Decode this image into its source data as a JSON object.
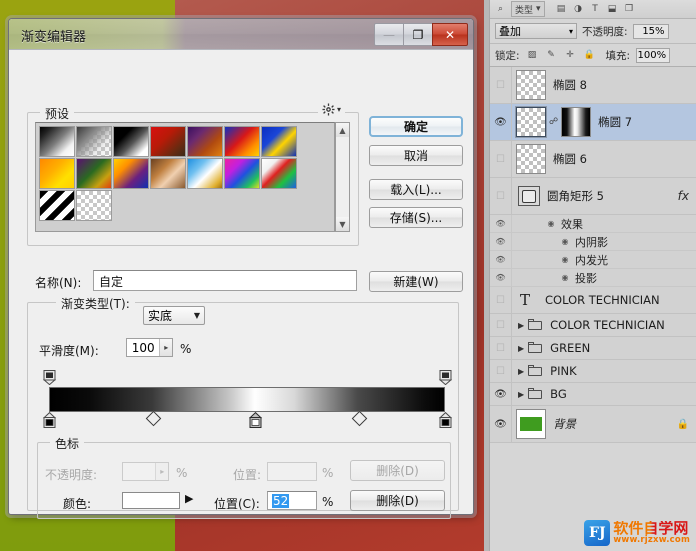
{
  "dialog": {
    "title": "渐变编辑器",
    "window_buttons": [
      {
        "name": "minimize",
        "glyph": "—",
        "state": "disabled"
      },
      {
        "name": "maximize",
        "glyph": "❐",
        "state": "enabled"
      },
      {
        "name": "close",
        "glyph": "✕",
        "state": "enabled"
      }
    ],
    "presets": {
      "label": "预设",
      "gear_icon": "gear-icon",
      "scroll_up": "▲",
      "scroll_down": "▼",
      "swatches": [
        "linear-gradient(135deg,#000 0%,#222 18%,#7d7d7d 50%,#f2f2f2 78%,#fff 100%)",
        "linear-gradient(135deg,#3a3a3a 0%,#8a8a8a 35%,rgba(180,180,180,0.25) 70%,rgba(255,255,255,0) 100%)",
        "linear-gradient(135deg,#000 0%,#000 30%,#555 55%,#fff 85%,#fff 100%)",
        "linear-gradient(135deg,#d81010 0%,#b81a08 40%,#6a2a10 75%,#3c2a18 100%)",
        "linear-gradient(135deg,#3a1060 0%,#6b2a70 30%,#b04a10 65%,#e08010 100%)",
        "linear-gradient(135deg,#1030c0 0%,#d81818 45%,#ff8c00 75%,#ffd000 100%)",
        "linear-gradient(135deg,#0a2ec0 0%,#1a46d8 35%,#ffd400 60%,#1030b8 100%)",
        "linear-gradient(135deg,#ff8800 0%,#ffb000 40%,#ffe000 70%,#ffd000 100%)",
        "linear-gradient(135deg,#5a1070 0%,#2a6a20 45%,#c8a010 75%,#e04010 100%)",
        "linear-gradient(135deg,#ffd000 0%,#ff9000 30%,#6a2080 65%,#1030b0 100%)",
        "linear-gradient(135deg,#6a4020 0%,#c08040 35%,#f0d0b0 60%,#8a5a30 100%)",
        "linear-gradient(135deg,#2090e0 0%,#70c0f0 30%,#ffffff 55%,#e0b030 85%,#a07010 100%)",
        "linear-gradient(135deg,#f020a0 0%,#c020e0 30%,#2050e0 55%,#20c060 80%,#e0e020 100%)",
        "linear-gradient(135deg,#ffffff 0%,#f0f0f0 25%,#e02020 45%,#20c040 70%,#2060e0 100%)",
        "repeating-linear-gradient(135deg,#000 0 6px,#fff 6px 12px)"
      ],
      "transparent_swatch_indexes": [
        1,
        15
      ]
    },
    "buttons": {
      "ok": "确定",
      "cancel": "取消",
      "load": "载入(L)...",
      "save": "存储(S)...",
      "new": "新建(W)"
    },
    "name_row": {
      "label": "名称(N):",
      "value": "自定"
    },
    "gradient_type": {
      "group_label": "渐变类型(T):",
      "value": "实底",
      "caret": "▼"
    },
    "smoothness": {
      "label": "平滑度(M):",
      "value": "100",
      "unit": "%",
      "arrow": "▸"
    },
    "gradient_bar": {
      "css": "linear-gradient(90deg,#000000 0%,#0a0a0a 10%,#3a3a3a 26%,#c9c9c9 46%,#ffffff 52%,#d8d8d8 62%,#4a4a4a 78%,#0c0c0c 95%,#000000 100%)",
      "opacity_stops": [
        {
          "position": 0,
          "opacity": 100
        },
        {
          "position": 100,
          "opacity": 100
        }
      ],
      "color_stops": [
        {
          "position": 0,
          "color": "#000000",
          "selected": false
        },
        {
          "position": 52,
          "color": "#ffffff",
          "selected": true
        },
        {
          "position": 100,
          "color": "#000000",
          "selected": false
        }
      ],
      "midpoints": [
        26,
        78
      ]
    },
    "stops_group": {
      "label": "色标",
      "opacity_label": "不透明度:",
      "opacity_value": "",
      "opacity_unit": "%",
      "opacity_position_label": "位置:",
      "opacity_position_value": "",
      "opacity_position_unit": "%",
      "delete_opacity": "删除(D)",
      "color_label": "颜色:",
      "color_value": "#ffffff",
      "color_caret": "▶",
      "color_position_label": "位置(C):",
      "color_position_value": "52",
      "color_position_unit": "%",
      "delete_color": "删除(D)"
    }
  },
  "layers_panel": {
    "filter": {
      "search_icon": "search-icon",
      "kind_label": "类型",
      "caret": "▾",
      "icons": [
        "image-icon",
        "adjustment-icon",
        "text-icon",
        "shape-icon",
        "smartobject-icon"
      ]
    },
    "blend": {
      "mode": "叠加",
      "caret": "▾",
      "opacity_label": "不透明度:",
      "opacity_value": "15%"
    },
    "lock": {
      "label": "锁定:",
      "icons": [
        "lock-transparent-icon",
        "lock-image-icon",
        "lock-position-icon",
        "lock-all-icon"
      ],
      "fill_label": "填充:",
      "fill_value": "100%"
    },
    "rows": [
      {
        "kind": "layer",
        "name": "椭圆 8",
        "visible": false,
        "selected": false,
        "thumb": "transparent"
      },
      {
        "kind": "layer",
        "name": "椭圆 7",
        "visible": true,
        "selected": true,
        "thumb": "transparent",
        "link": "⛓",
        "mask": true
      },
      {
        "kind": "layer",
        "name": "椭圆 6",
        "visible": false,
        "selected": false,
        "thumb": "transparent"
      },
      {
        "kind": "shape",
        "name": "圆角矩形 5",
        "visible": false,
        "selected": false,
        "fx": "fx"
      },
      {
        "kind": "effects-head",
        "name": "效果",
        "visible": true
      },
      {
        "kind": "effect",
        "name": "内阴影",
        "visible": true
      },
      {
        "kind": "effect",
        "name": "内发光",
        "visible": true
      },
      {
        "kind": "effect",
        "name": "投影",
        "visible": true
      },
      {
        "kind": "text",
        "name": "COLOR TECHNICIAN",
        "visible": false,
        "glyph": "T"
      },
      {
        "kind": "group",
        "name": "COLOR TECHNICIAN",
        "visible": false,
        "arrow": "▶"
      },
      {
        "kind": "group",
        "name": "GREEN",
        "visible": false,
        "arrow": "▶"
      },
      {
        "kind": "group",
        "name": "PINK",
        "visible": false,
        "arrow": "▶"
      },
      {
        "kind": "group",
        "name": "BG",
        "visible": true,
        "arrow": "▶"
      },
      {
        "kind": "background",
        "name": "背景",
        "visible": true,
        "thumb": "green",
        "lock": "🔒"
      }
    ]
  },
  "watermark": {
    "logo": "FJ",
    "name": "软件自学网",
    "url": "www.rjzxw.com"
  },
  "canvas": {
    "green": "#8ea00f",
    "red": "#a94136"
  }
}
